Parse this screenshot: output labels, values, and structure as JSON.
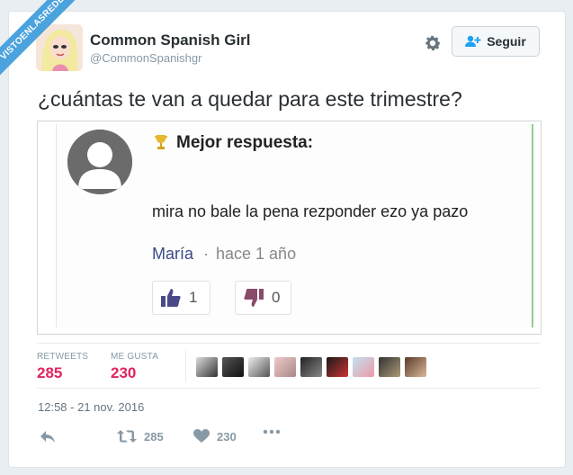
{
  "watermark": "VISTOENLASREDES",
  "account": {
    "name": "Common Spanish Girl",
    "handle": "@CommonSpanishgr"
  },
  "follow_label": "Seguir",
  "tweet_text": "¿cuántas te van a quedar para este trimestre?",
  "embed": {
    "best_label": "Mejor respuesta:",
    "answer": "mira no bale la pena rezponder ezo ya pazo",
    "author": "María",
    "separator": "·",
    "time_ago": "hace 1 año",
    "upvotes": "1",
    "downvotes": "0"
  },
  "stats": {
    "retweets_label": "RETWEETS",
    "retweets_value": "285",
    "likes_label": "ME GUSTA",
    "likes_value": "230"
  },
  "likers": [
    "liker-1",
    "liker-2",
    "liker-3",
    "liker-4",
    "liker-5",
    "liker-6",
    "liker-7",
    "liker-8",
    "liker-9",
    "liker-10"
  ],
  "timestamp": "12:58 - 21 nov. 2016",
  "actions": {
    "retweet_count": "285",
    "like_count": "230"
  },
  "colors": {
    "accent": "#1da1f2",
    "like": "#e0245e",
    "ribbon": "#4aa3dd"
  }
}
